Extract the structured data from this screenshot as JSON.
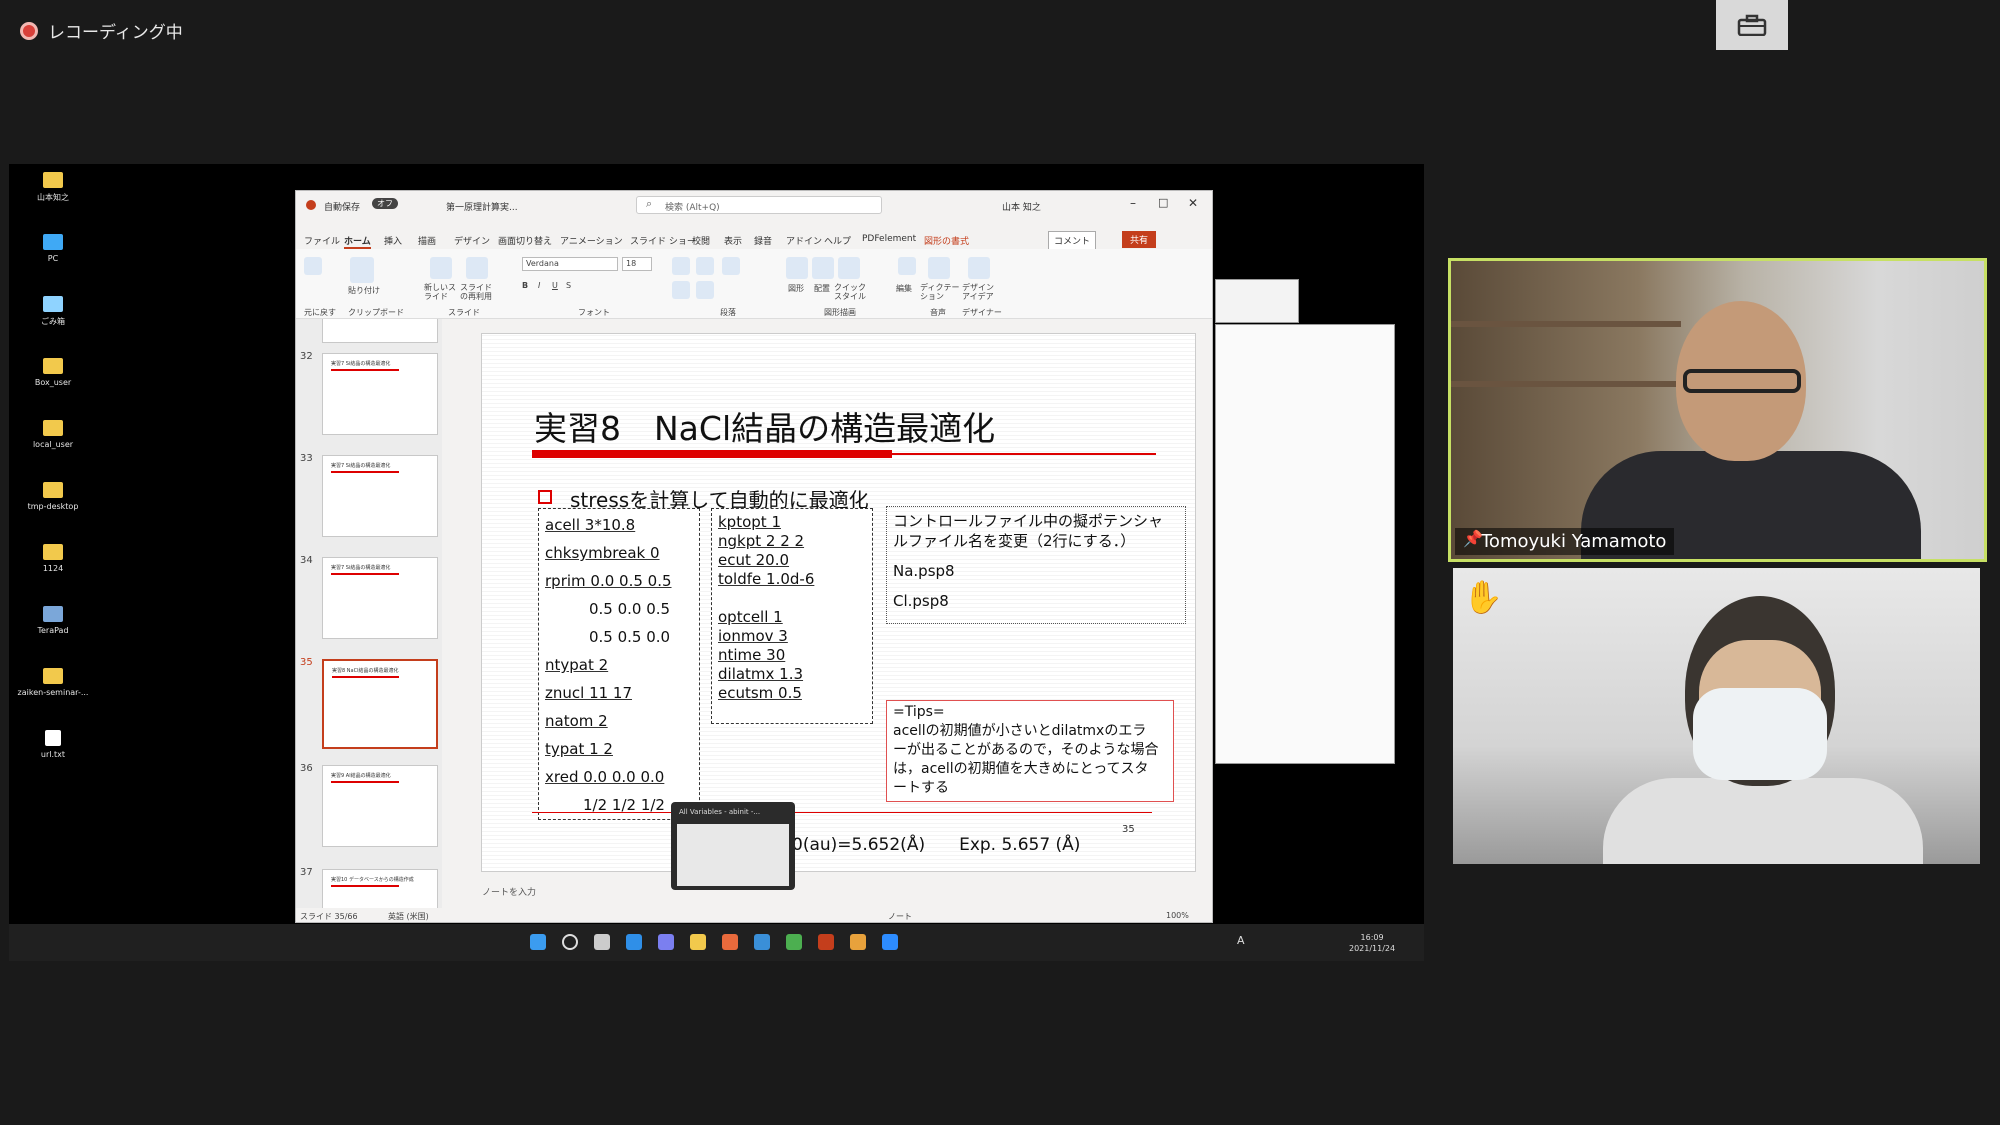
{
  "recording": {
    "label": "レコーディング中"
  },
  "desktop_icons": [
    {
      "label": "山本知之",
      "icon": "folder-icon"
    },
    {
      "label": "PC",
      "icon": "pc-icon"
    },
    {
      "label": "ごみ箱",
      "icon": "recycle-bin-icon"
    },
    {
      "label": "Box_user",
      "icon": "folder-icon"
    },
    {
      "label": "local_user",
      "icon": "folder-icon"
    },
    {
      "label": "tmp-desktop",
      "icon": "folder-icon"
    },
    {
      "label": "1124",
      "icon": "folder-icon"
    },
    {
      "label": "TeraPad",
      "icon": "terapad-icon"
    },
    {
      "label": "zaiken-seminar-...",
      "icon": "folder-icon"
    },
    {
      "label": "url.txt",
      "icon": "file-icon"
    }
  ],
  "ppt": {
    "autosave": "自動保存",
    "autosave_state": "オフ",
    "doc_title": "第一原理計算実...",
    "search_placeholder": "検索 (Alt+Q)",
    "user": "山本 知之",
    "menu": [
      "ファイル",
      "ホーム",
      "挿入",
      "描画",
      "デザイン",
      "画面切り替え",
      "アニメーション",
      "スライド ショー",
      "校閲",
      "表示",
      "録音",
      "アドイン",
      "ヘルプ",
      "PDFelement",
      "図形の書式"
    ],
    "comment_btn": "コメント",
    "share_btn": "共有",
    "ribbon": {
      "font_name": "Verdana",
      "font_size": "18",
      "groups": [
        "元に戻す",
        "クリップボード",
        "スライド",
        "フォント",
        "段落",
        "図形描画",
        "音声",
        "デザイナー"
      ],
      "paste": "貼り付け",
      "new_slide": "新しいスライド",
      "reuse": "スライドの再利用",
      "shape": "図形",
      "arrange": "配置",
      "quick_style": "クイック スタイル",
      "edit": "編集",
      "dictate": "ディクテーション",
      "design_idea": "デザイン アイデア"
    },
    "thumbnails": [
      {
        "num": "32",
        "title": "実習7 Si結晶の構造最適化"
      },
      {
        "num": "33",
        "title": "実習7 Si結晶の構造最適化"
      },
      {
        "num": "34",
        "title": "実習7 Si結晶の構造最適化"
      },
      {
        "num": "35",
        "title": "実習8 NaCl結晶の構造最適化"
      },
      {
        "num": "36",
        "title": "実習9 Al結晶の構造最適化"
      },
      {
        "num": "37",
        "title": "実習10 データベースからの構造作成"
      }
    ],
    "slide": {
      "title": "実習8　NaCl結晶の構造最適化",
      "bullet": "stressを計算して自動的に最適化",
      "box1": [
        "acell 3*10.8",
        "chksymbreak 0",
        "rprim 0.0 0.5 0.5",
        "        0.5 0.0 0.5",
        "        0.5 0.5 0.0",
        "ntypat 2",
        "znucl 11 17",
        "natom 2",
        "typat 1 2",
        "xred 0.0 0.0 0.0",
        "      1/2 1/2 1/2"
      ],
      "box2": [
        "kptopt 1",
        "ngkpt 2 2 2",
        "ecut 20.0",
        "toldfe 1.0d-6",
        "",
        "optcell 1",
        "ionmov 3",
        "ntime 30",
        "dilatmx 1.3",
        "ecutsm 0.5"
      ],
      "box3_lines": [
        "コントロールファイル中の擬ポテンシャ",
        "ルファイル名を変更（2行にする．）",
        "Na.psp8",
        "Cl.psp8"
      ],
      "tips_lines": [
        "=Tips=",
        "acellの初期値が小さいとdilatmxのエラ",
        "ーが出ることがあるので，そのような場合",
        "は，acellの初期値を大きめにとってスタ",
        "ートする"
      ],
      "result": "0(au)=5.652(Å)　　Exp. 5.657 (Å)",
      "page_number": "35"
    },
    "notes_placeholder": "ノートを入力",
    "status": {
      "slide": "スライド 35/66",
      "lang": "英語 (米国)",
      "notes": "ノート",
      "zoom": "100%"
    }
  },
  "preview": {
    "title": "All Variables - abinit -..."
  },
  "clock": {
    "time": "16:09",
    "date": "2021/11/24"
  },
  "taskbar_ime": "A",
  "participants": [
    {
      "name": "Tomoyuki Yamamoto"
    },
    {
      "name": ""
    }
  ],
  "colors": {
    "accent_red": "#d00000",
    "active_speaker": "#c7e064",
    "ppt_share": "#c43e1c"
  }
}
